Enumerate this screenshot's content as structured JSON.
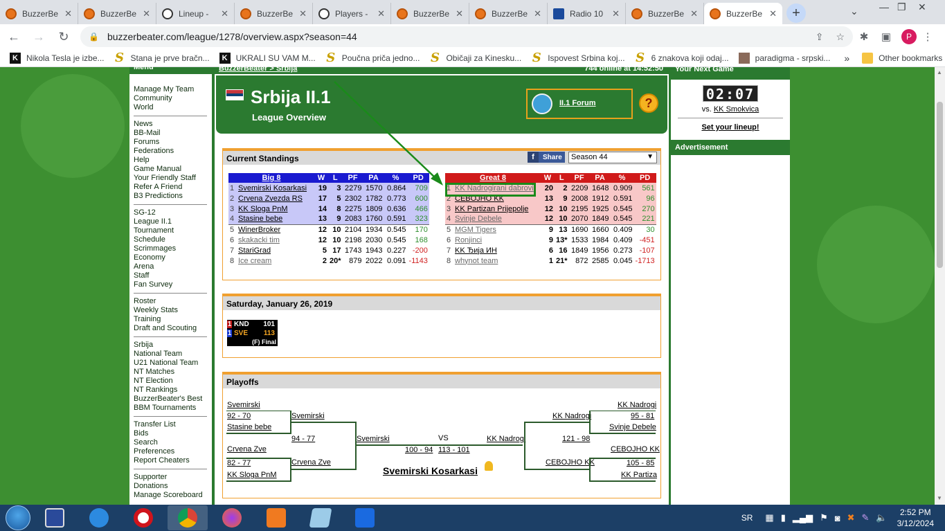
{
  "browser": {
    "tabs": [
      {
        "title": "BuzzerBe",
        "icon": "basketball-icon"
      },
      {
        "title": "BuzzerBe",
        "icon": "basketball-icon"
      },
      {
        "title": "Lineup -",
        "icon": "soccer-ball-icon"
      },
      {
        "title": "BuzzerBe",
        "icon": "basketball-icon"
      },
      {
        "title": "Players -",
        "icon": "soccer-ball-icon"
      },
      {
        "title": "BuzzerBe",
        "icon": "basketball-icon"
      },
      {
        "title": "BuzzerBe",
        "icon": "basketball-icon"
      },
      {
        "title": "Radio 10",
        "icon": "radio-icon"
      },
      {
        "title": "BuzzerBe",
        "icon": "basketball-icon"
      },
      {
        "title": "BuzzerBe",
        "icon": "basketball-icon"
      }
    ],
    "url": "buzzerbeater.com/league/1278/overview.aspx?season=44",
    "profile_initial": "P",
    "bookmarks": [
      {
        "label": "Nikola Tesla je izbe...",
        "icon": "k"
      },
      {
        "label": "Stana je prve bračn...",
        "icon": "s"
      },
      {
        "label": "UKRALI SU VAM M...",
        "icon": "k"
      },
      {
        "label": "Poučna priča jedno...",
        "icon": "s"
      },
      {
        "label": "Običaji za Kinesku...",
        "icon": "s"
      },
      {
        "label": "Ispovest Srbina koj...",
        "icon": "s"
      },
      {
        "label": "6 znakova koji odaj...",
        "icon": "s"
      },
      {
        "label": "paradigma - srpski...",
        "icon": "p"
      }
    ],
    "bookmarks_more": "»",
    "other_bookmarks": "Other bookmarks"
  },
  "menu": {
    "header": "Menu",
    "groups": [
      [
        "Manage My Team",
        "Community",
        "World"
      ],
      [
        "News",
        "BB-Mail",
        "Forums",
        "Federations",
        "Help",
        "Game Manual",
        "Your Friendly Staff",
        "Refer A Friend",
        "B3 Predictions"
      ],
      [
        "SG-12",
        "League II.1",
        "Tournament",
        "Schedule",
        "Scrimmages",
        "Economy",
        "Arena",
        "Staff",
        "Fan Survey"
      ],
      [
        "Roster",
        "Weekly Stats",
        "Training",
        "Draft and Scouting"
      ],
      [
        "Srbija",
        "National Team",
        "U21 National Team",
        "NT Matches",
        "NT Election",
        "NT Rankings",
        "BuzzerBeater's Best",
        "BBM Tournaments"
      ],
      [
        "Transfer List",
        "Bids",
        "Search",
        "Preferences",
        "Report Cheaters"
      ],
      [
        "Supporter",
        "Donations",
        "Manage Scoreboard"
      ]
    ]
  },
  "crumb": {
    "left": "BuzzerBeater > Srbija",
    "right": "744 online at 14:52:50"
  },
  "league": {
    "title": "Srbija II.1",
    "subtitle": "League Overview",
    "forum_link": "II.1 Forum",
    "help": "?"
  },
  "standings": {
    "header": "Current Standings",
    "share": "Share",
    "season": "Season 44",
    "columns": [
      "W",
      "L",
      "PF",
      "PA",
      "%",
      "PD"
    ],
    "conferences": [
      {
        "name": "Big 8",
        "color": "#1a1ad0",
        "rows": [
          {
            "rank": "1",
            "team": "Svemirski Kosarkasi",
            "w": "19",
            "l": "3",
            "pf": "2279",
            "pa": "1570",
            "pct": "0.864",
            "pd": "709"
          },
          {
            "rank": "2",
            "team": "Crvena Zvezda RS",
            "w": "17",
            "l": "5",
            "pf": "2302",
            "pa": "1782",
            "pct": "0.773",
            "pd": "600"
          },
          {
            "rank": "3",
            "team": "KK Sloga PnM",
            "w": "14",
            "l": "8",
            "pf": "2275",
            "pa": "1809",
            "pct": "0.636",
            "pd": "466"
          },
          {
            "rank": "4",
            "team": "Stasine bebe",
            "w": "13",
            "l": "9",
            "pf": "2083",
            "pa": "1760",
            "pct": "0.591",
            "pd": "323"
          },
          {
            "rank": "5",
            "team": "WinerBroker",
            "w": "12",
            "l": "10",
            "pf": "2104",
            "pa": "1934",
            "pct": "0.545",
            "pd": "170"
          },
          {
            "rank": "6",
            "team": "skakacki tim",
            "w": "12",
            "l": "10",
            "pf": "2198",
            "pa": "2030",
            "pct": "0.545",
            "pd": "168"
          },
          {
            "rank": "7",
            "team": "StariGrad",
            "w": "5",
            "l": "17",
            "pf": "1743",
            "pa": "1943",
            "pct": "0.227",
            "pd": "-200"
          },
          {
            "rank": "8",
            "team": "Ice cream",
            "w": "2",
            "l": "20*",
            "pf": "879",
            "pa": "2022",
            "pct": "0.091",
            "pd": "-1143"
          }
        ]
      },
      {
        "name": "Great 8",
        "color": "#d01a1a",
        "rows": [
          {
            "rank": "1",
            "team": "KK Nadrogirani dabrovi",
            "w": "20",
            "l": "2",
            "pf": "2209",
            "pa": "1648",
            "pct": "0.909",
            "pd": "561"
          },
          {
            "rank": "2",
            "team": "CEBOJHO KK",
            "w": "13",
            "l": "9",
            "pf": "2008",
            "pa": "1912",
            "pct": "0.591",
            "pd": "96"
          },
          {
            "rank": "3",
            "team": "KK Partizan Prijepolje",
            "w": "12",
            "l": "10",
            "pf": "2195",
            "pa": "1925",
            "pct": "0.545",
            "pd": "270"
          },
          {
            "rank": "4",
            "team": "Svinje Debele",
            "w": "12",
            "l": "10",
            "pf": "2070",
            "pa": "1849",
            "pct": "0.545",
            "pd": "221"
          },
          {
            "rank": "5",
            "team": "MGM Tigers",
            "w": "9",
            "l": "13",
            "pf": "1690",
            "pa": "1660",
            "pct": "0.409",
            "pd": "30"
          },
          {
            "rank": "6",
            "team": "Ronjinci",
            "w": "9",
            "l": "13*",
            "pf": "1533",
            "pa": "1984",
            "pct": "0.409",
            "pd": "-451"
          },
          {
            "rank": "7",
            "team": "KK Ђија ИН",
            "w": "6",
            "l": "16",
            "pf": "1849",
            "pa": "1956",
            "pct": "0.273",
            "pd": "-107"
          },
          {
            "rank": "8",
            "team": "whynot team",
            "w": "1",
            "l": "21*",
            "pf": "872",
            "pa": "2585",
            "pct": "0.045",
            "pd": "-1713"
          }
        ]
      }
    ]
  },
  "games": {
    "header": "Saturday, January 26, 2019",
    "game": {
      "home_seed": "1",
      "home": "KND",
      "home_score": "101",
      "away_seed": "1",
      "away": "SVE",
      "away_score": "113",
      "status": "(F) Final"
    }
  },
  "playoffs": {
    "header": "Playoffs",
    "left": {
      "r1a_top": "Svemirski",
      "r1a_score": "92 - 70",
      "r1a_bot": "Stasine bebe",
      "r1b_top": "Crvena Zve",
      "r1b_score": "82 - 77",
      "r1b_bot": "KK Sloga PnM",
      "r2_top": "Svemirski",
      "r2_score": "94 - 77",
      "r2_bot": "Crvena Zve",
      "final": "Svemirski",
      "final_score": "100 - 94"
    },
    "right": {
      "r1a_top": "KK Nadrogi",
      "r1a_score": "95 - 81",
      "r1a_bot": "Svinje Debele",
      "r1b_top": "CEBOJHO KK",
      "r1b_score": "105 - 85",
      "r1b_bot": "KK Partiza",
      "r2_top": "KK Nadrogi",
      "r2_score": "121 - 98",
      "r2_bot": "CEBOJHO KK",
      "final": "KK Nadrogi",
      "final_score": "113 - 101"
    },
    "vs": "VS",
    "champion": "Svemirski Kosarkasi"
  },
  "right_col": {
    "next_game_header": "Your Next Game",
    "clock": "02:07",
    "vs_prefix": "vs.",
    "opponent": "KK Smokvica",
    "lineup": "Set your lineup!",
    "ad_header": "Advertisement"
  },
  "taskbar": {
    "lang": "SR",
    "time": "2:52 PM",
    "date": "3/12/2024"
  }
}
